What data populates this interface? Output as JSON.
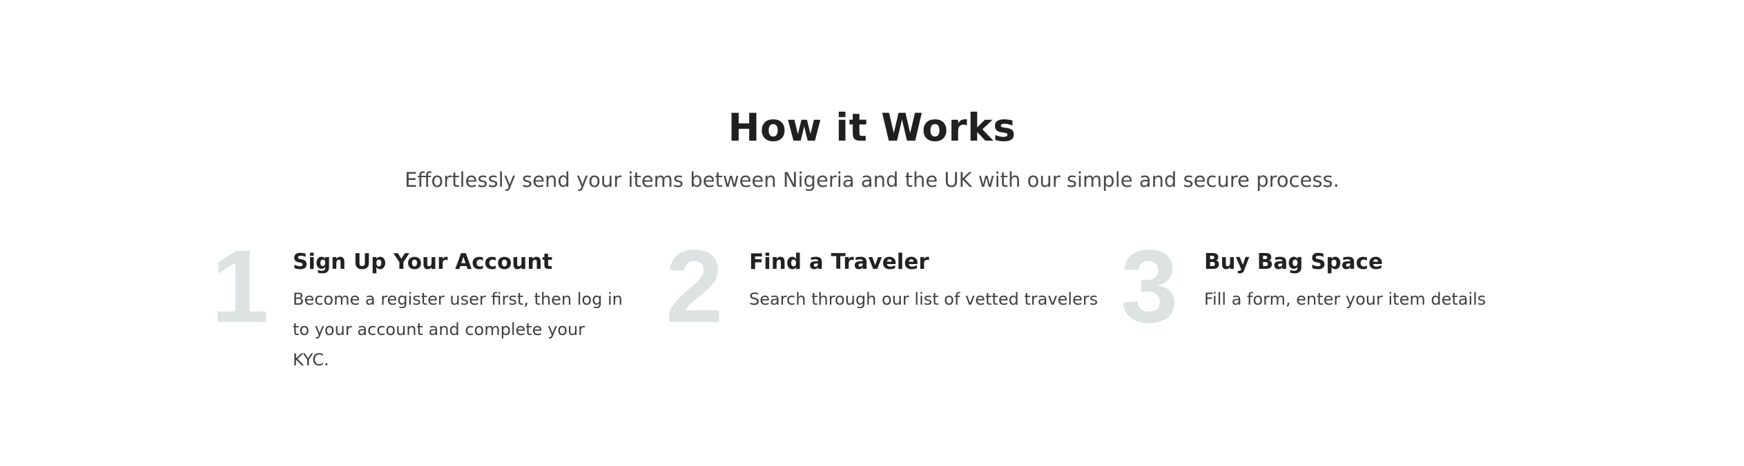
{
  "section": {
    "title": "How it Works",
    "subtitle": "Effortlessly send your items between Nigeria and the UK with our simple and secure process."
  },
  "steps": [
    {
      "number": "1",
      "title": "Sign Up Your Account",
      "description": "Become a register user first, then log in to your account and complete your KYC."
    },
    {
      "number": "2",
      "title": "Find a Traveler",
      "description": "Search through our list of vetted travelers"
    },
    {
      "number": "3",
      "title": "Buy Bag Space",
      "description": "Fill a form, enter your item details"
    }
  ],
  "colors": {
    "heading": "#202020",
    "subtitle": "#4a4a4a",
    "step_number": "#dde2e3",
    "background": "#ffffff"
  }
}
